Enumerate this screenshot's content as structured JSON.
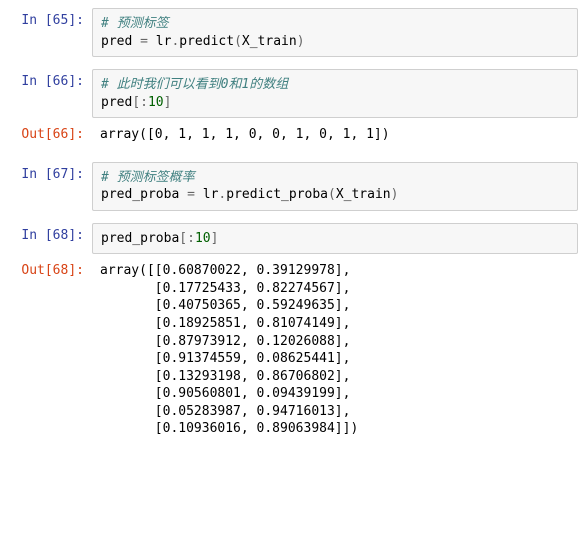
{
  "cells": {
    "c65": {
      "in_prompt": "In  [65]:",
      "comment": "# 预测标签",
      "line2_var": "pred",
      "line2_assign": " = ",
      "line2_obj": "lr",
      "line2_dot": ".",
      "line2_fn": "predict",
      "line2_open": "(",
      "line2_arg": "X_train",
      "line2_close": ")"
    },
    "c66": {
      "in_prompt": "In  [66]:",
      "comment": "# 此时我们可以看到0和1的数组",
      "line2_var": "pred",
      "line2_open": "[",
      "line2_colon": ":",
      "line2_num": "10",
      "line2_close": "]",
      "out_prompt": "Out[66]:",
      "output": "array([0, 1, 1, 1, 0, 0, 1, 0, 1, 1])"
    },
    "c67": {
      "in_prompt": "In  [67]:",
      "comment": "# 预测标签概率",
      "line2_var": "pred_proba",
      "line2_assign": " = ",
      "line2_obj": "lr",
      "line2_dot": ".",
      "line2_fn": "predict_proba",
      "line2_open": "(",
      "line2_arg": "X_train",
      "line2_close": ")"
    },
    "c68": {
      "in_prompt": "In  [68]:",
      "line1_var": "pred_proba",
      "line1_open": "[",
      "line1_colon": ":",
      "line1_num": "10",
      "line1_close": "]",
      "out_prompt": "Out[68]:",
      "output": "array([[0.60870022, 0.39129978],\n       [0.17725433, 0.82274567],\n       [0.40750365, 0.59249635],\n       [0.18925851, 0.81074149],\n       [0.87973912, 0.12026088],\n       [0.91374559, 0.08625441],\n       [0.13293198, 0.86706802],\n       [0.90560801, 0.09439199],\n       [0.05283987, 0.94716013],\n       [0.10936016, 0.89063984]])"
    }
  },
  "chart_data": null
}
